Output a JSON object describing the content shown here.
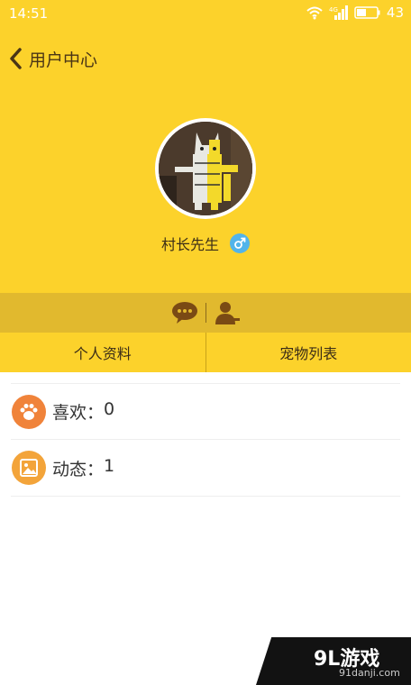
{
  "status_bar": {
    "time": "14:51",
    "battery": "43"
  },
  "header": {
    "title": "用户中心",
    "username": "村长先生"
  },
  "tabs": [
    {
      "label": "个人资料"
    },
    {
      "label": "宠物列表"
    }
  ],
  "stats": [
    {
      "label": "喜欢：",
      "value": "0",
      "icon": "paw-icon",
      "color": "#f0833a"
    },
    {
      "label": "动态：",
      "value": "1",
      "icon": "picture-icon",
      "color": "#f3a43a"
    }
  ],
  "watermark": {
    "brand": "9L游戏",
    "url": "91danji.com"
  },
  "colors": {
    "primary": "#fcd22b",
    "strip": "#e1b92e",
    "icon_brown": "#7a4a14",
    "gender_blue": "#52b4ea"
  }
}
